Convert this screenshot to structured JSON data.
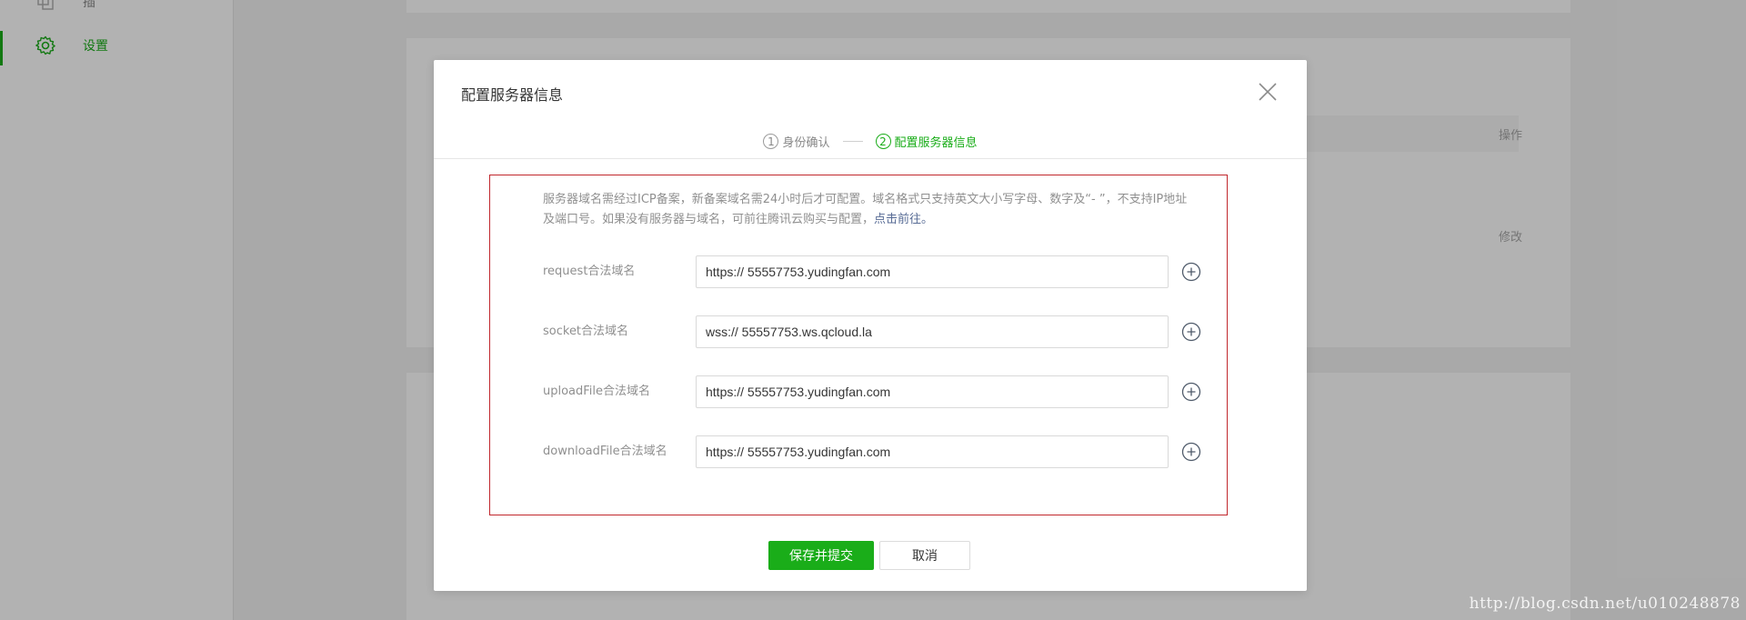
{
  "sidebar": {
    "items": [
      {
        "label": "插",
        "icon": "plugin-icon",
        "active": false
      },
      {
        "label": "设置",
        "icon": "gear-icon",
        "active": true
      }
    ]
  },
  "background": {
    "column_header": "操作",
    "row_action": "修改"
  },
  "dialog": {
    "title": "配置服务器信息",
    "steps": [
      {
        "num": "1",
        "label": "身份确认",
        "state": "done"
      },
      {
        "num": "2",
        "label": "配置服务器信息",
        "state": "current"
      }
    ],
    "tips": {
      "text": "服务器域名需经过ICP备案，新备案域名需24小时后才可配置。域名格式只支持英文大小写字母、数字及“- ”，不支持IP地址及端口号。如果没有服务器与域名，可前往腾讯云购买与配置，",
      "link": "点击前往。"
    },
    "fields": [
      {
        "label": "request合法域名",
        "value": "https:// 55557753.yudingfan.com"
      },
      {
        "label": "socket合法域名",
        "value": "wss:// 55557753.ws.qcloud.la"
      },
      {
        "label": "uploadFile合法域名",
        "value": "https:// 55557753.yudingfan.com"
      },
      {
        "label": "downloadFile合法域名",
        "value": "https:// 55557753.yudingfan.com"
      }
    ],
    "buttons": {
      "submit": "保存并提交",
      "cancel": "取消"
    }
  },
  "watermark": "http://blog.csdn.net/u010248878",
  "colors": {
    "accent": "#1aad19",
    "highlight_border": "#c1272d",
    "link": "#576b95"
  }
}
